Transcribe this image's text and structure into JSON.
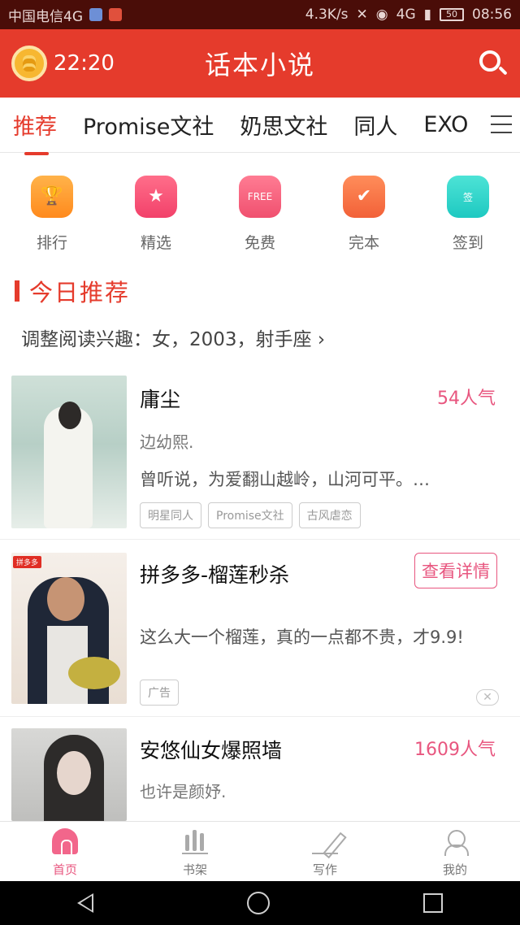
{
  "status_bar": {
    "carrier": "中国电信4G",
    "speed": "4.3K/s",
    "network": "4G",
    "battery": "50",
    "time": "08:56"
  },
  "header": {
    "clock_time": "22:20",
    "title": "话本小说"
  },
  "tabs": [
    {
      "label": "推荐",
      "active": true
    },
    {
      "label": "Promise文社"
    },
    {
      "label": "奶思文社"
    },
    {
      "label": "同人"
    },
    {
      "label": "EXO"
    }
  ],
  "quick_entries": [
    {
      "label": "排行",
      "icon": "trophy-icon"
    },
    {
      "label": "精选",
      "icon": "star-icon"
    },
    {
      "label": "免费",
      "icon": "free-icon",
      "badge": "FREE"
    },
    {
      "label": "完本",
      "icon": "check-icon"
    },
    {
      "label": "签到",
      "icon": "sign-icon",
      "badge": "签"
    }
  ],
  "section": {
    "title": "今日推荐",
    "interest": "调整阅读兴趣：女，2003，射手座 ›"
  },
  "books": [
    {
      "title": "庸尘",
      "popularity": "54人气",
      "author": "边幼熙.",
      "desc": "曾听说，为爱翻山越岭，山河可平。…",
      "tags": [
        "明星同人",
        "Promise文社",
        "古风虐恋"
      ]
    },
    {
      "title": "拼多多-榴莲秒杀",
      "button": "查看详情",
      "desc": "这么大一个榴莲，真的一点都不贵，才9.9!",
      "tags": [
        "广告"
      ],
      "close": "✕",
      "logo": "拼多多"
    },
    {
      "title": "安悠仙女爆照墙",
      "popularity": "1609人气",
      "author": "也许是颜妤."
    }
  ],
  "bottom_nav": [
    {
      "label": "首页",
      "active": true
    },
    {
      "label": "书架"
    },
    {
      "label": "写作"
    },
    {
      "label": "我的"
    }
  ],
  "colors": {
    "brand": "#e53b2c",
    "accent_pink": "#e8567f"
  }
}
